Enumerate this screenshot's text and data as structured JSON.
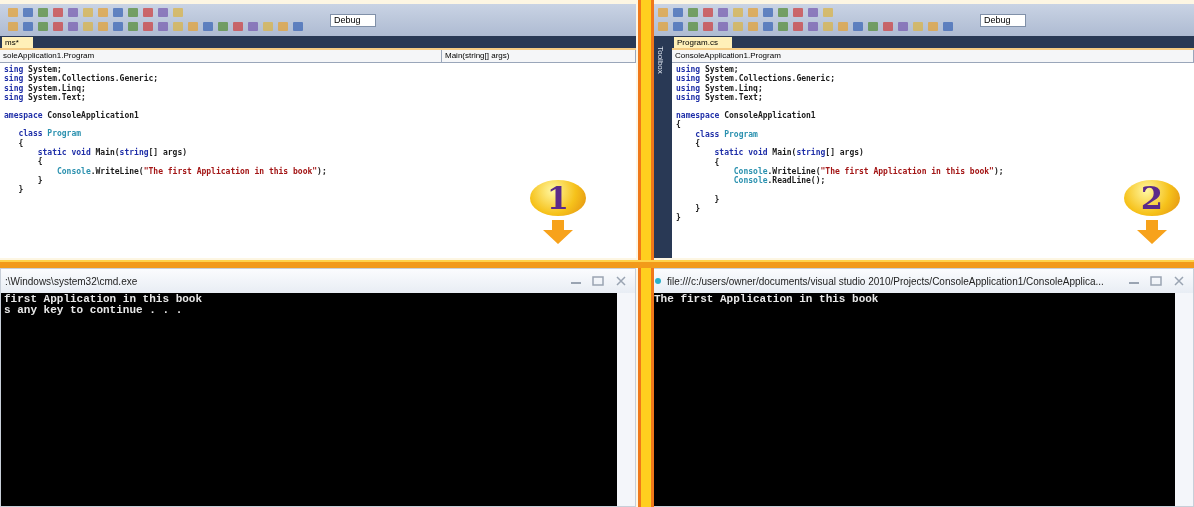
{
  "panels": [
    {
      "editor": {
        "config": "Debug",
        "tab": {
          "label": "ms*",
          "selected": true
        },
        "nav_left": "soleApplication1.Program",
        "nav_right": "Main(string[] args)",
        "lines": [
          {
            "segments": [
              {
                "kind": "keyword",
                "text": "sing"
              },
              {
                "kind": "plain",
                "text": " System;"
              }
            ]
          },
          {
            "segments": [
              {
                "kind": "keyword",
                "text": "sing"
              },
              {
                "kind": "plain",
                "text": " System.Collections.Generic;"
              }
            ]
          },
          {
            "segments": [
              {
                "kind": "keyword",
                "text": "sing"
              },
              {
                "kind": "plain",
                "text": " System.Linq;"
              }
            ]
          },
          {
            "segments": [
              {
                "kind": "keyword",
                "text": "sing"
              },
              {
                "kind": "plain",
                "text": " System.Text;"
              }
            ]
          },
          {
            "blank_before": true,
            "segments": [
              {
                "kind": "keyword",
                "text": "amespace"
              },
              {
                "kind": "plain",
                "text": " ConsoleApplication1"
              }
            ]
          },
          {
            "blank_before": true,
            "segments": [
              {
                "kind": "keyword",
                "text": "   class"
              },
              {
                "kind": "type",
                "text": " Program"
              }
            ]
          },
          {
            "segments": [
              {
                "kind": "plain",
                "text": "   {"
              }
            ]
          },
          {
            "segments": [
              {
                "kind": "keyword",
                "text": "       static void"
              },
              {
                "kind": "plain",
                "text": " Main("
              },
              {
                "kind": "keyword",
                "text": "string"
              },
              {
                "kind": "plain",
                "text": "[] args)"
              }
            ]
          },
          {
            "segments": [
              {
                "kind": "plain",
                "text": "       {"
              }
            ]
          },
          {
            "segments": [
              {
                "kind": "type",
                "text": "           Console"
              },
              {
                "kind": "plain",
                "text": ".WriteLine("
              },
              {
                "kind": "string",
                "text": "\"The first Application in this book\""
              },
              {
                "kind": "plain",
                "text": ");"
              }
            ]
          },
          {
            "segments": [
              {
                "kind": "plain",
                "text": "       }"
              }
            ]
          },
          {
            "segments": [
              {
                "kind": "plain",
                "text": "   }"
              }
            ]
          }
        ]
      },
      "badge": "1",
      "console": {
        "title": ":\\Windows\\system32\\cmd.exe",
        "lines": [
          "first Application in this book",
          "s any key to continue . . ."
        ]
      }
    },
    {
      "editor": {
        "config": "Debug",
        "tab": {
          "label": "Program.cs",
          "selected": true
        },
        "side_label": "Toolbox",
        "nav_left": "ConsoleApplication1.Program",
        "lines": [
          {
            "segments": [
              {
                "kind": "keyword",
                "text": "using"
              },
              {
                "kind": "plain",
                "text": " System;"
              }
            ]
          },
          {
            "segments": [
              {
                "kind": "keyword",
                "text": "using"
              },
              {
                "kind": "plain",
                "text": " System.Collections.Generic;"
              }
            ]
          },
          {
            "segments": [
              {
                "kind": "keyword",
                "text": "using"
              },
              {
                "kind": "plain",
                "text": " System.Linq;"
              }
            ]
          },
          {
            "segments": [
              {
                "kind": "keyword",
                "text": "using"
              },
              {
                "kind": "plain",
                "text": " System.Text;"
              }
            ]
          },
          {
            "blank_before": true,
            "segments": [
              {
                "kind": "keyword",
                "text": "namespace"
              },
              {
                "kind": "plain",
                "text": " ConsoleApplication1"
              }
            ]
          },
          {
            "segments": [
              {
                "kind": "plain",
                "text": "{"
              }
            ]
          },
          {
            "segments": [
              {
                "kind": "keyword",
                "text": "    class"
              },
              {
                "kind": "type",
                "text": " Program"
              }
            ]
          },
          {
            "segments": [
              {
                "kind": "plain",
                "text": "    {"
              }
            ]
          },
          {
            "segments": [
              {
                "kind": "keyword",
                "text": "        static void"
              },
              {
                "kind": "plain",
                "text": " Main("
              },
              {
                "kind": "keyword",
                "text": "string"
              },
              {
                "kind": "plain",
                "text": "[] args)"
              }
            ]
          },
          {
            "segments": [
              {
                "kind": "plain",
                "text": "        {"
              }
            ]
          },
          {
            "segments": [
              {
                "kind": "type",
                "text": "            Console"
              },
              {
                "kind": "plain",
                "text": ".WriteLine("
              },
              {
                "kind": "string",
                "text": "\"The first Application in this book\""
              },
              {
                "kind": "plain",
                "text": ");"
              }
            ]
          },
          {
            "segments": [
              {
                "kind": "type",
                "text": "            Console"
              },
              {
                "kind": "plain",
                "text": ".ReadLine();"
              }
            ]
          },
          {
            "blank_before": true,
            "segments": [
              {
                "kind": "plain",
                "text": "        }"
              }
            ]
          },
          {
            "segments": [
              {
                "kind": "plain",
                "text": "    }"
              }
            ]
          },
          {
            "segments": [
              {
                "kind": "plain",
                "text": "}"
              }
            ]
          }
        ]
      },
      "badge": "2",
      "console": {
        "title": "file:///c:/users/owner/documents/visual studio 2010/Projects/ConsoleApplication1/ConsoleApplica...",
        "icon": true,
        "lines": [
          "The first Application in this book"
        ]
      }
    }
  ]
}
